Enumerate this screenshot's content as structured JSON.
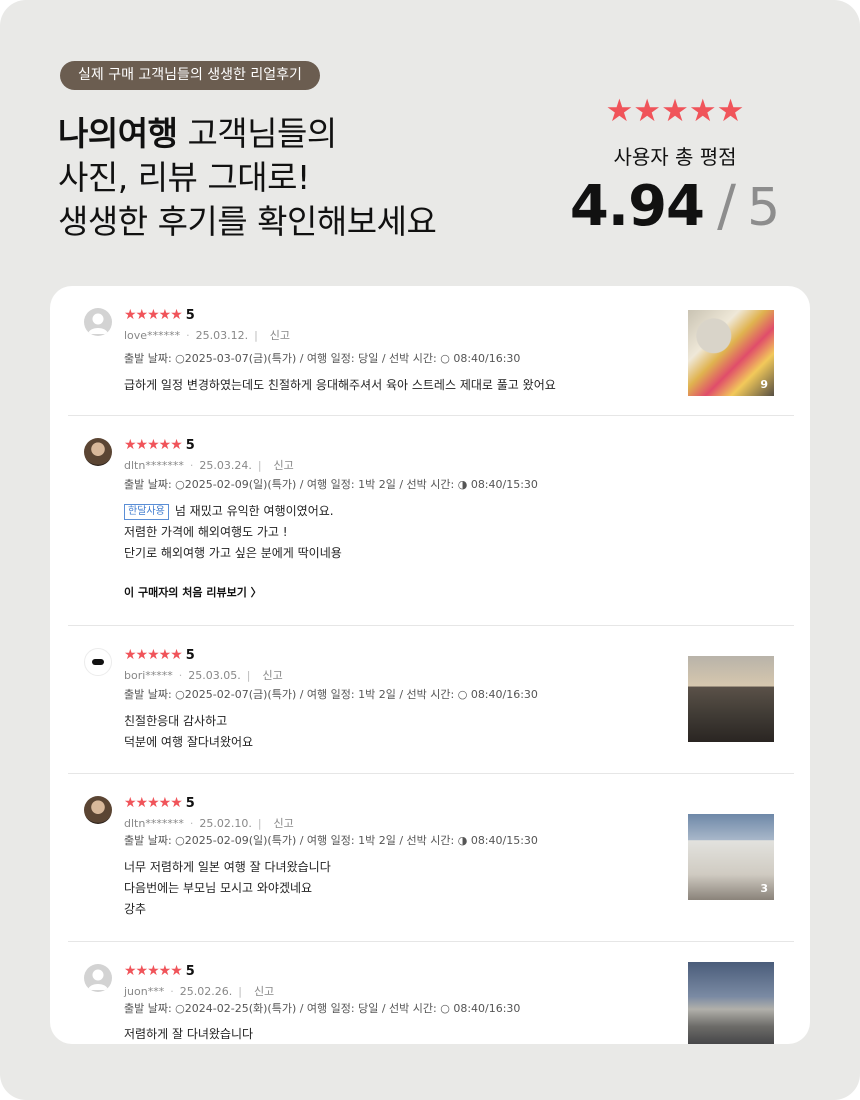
{
  "header": {
    "badge": "실제 구매 고객님들의 생생한 리얼후기",
    "headline_brand": "나의여행",
    "headline_rest": " 고객님들의",
    "headline_line2": "사진, 리뷰 그대로!",
    "headline_line3": "생생한 후기를 확인해보세요"
  },
  "rating": {
    "stars": "★★★★★",
    "label": "사용자 총 평점",
    "score": "4.94",
    "separator": "/",
    "max": "5"
  },
  "reviews": [
    {
      "stars": "★★★★★",
      "score": "5",
      "user": "love******",
      "date": "25.03.12.",
      "report": "신고",
      "option": "출발 날짜: ○2025-03-07(금)(특가) / 여행 일정: 당일 / 선박 시간: ○ 08:40/16:30",
      "lines": [
        "급하게 일정 변경하였는데도 친절하게 응대해주셔서 육아 스트레스 제대로 풀고 왔어요"
      ],
      "photo_count": "9"
    },
    {
      "stars": "★★★★★",
      "score": "5",
      "user": "dltn*******",
      "date": "25.03.24.",
      "report": "신고",
      "option": "출발 날짜: ○2025-02-09(일)(특가) / 여행 일정: 1박 2일 / 선박 시간: ◑ 08:40/15:30",
      "tag": "한달사용",
      "lines": [
        "넘 재밌고 유익한 여행이였어요.",
        "저렴한 가격에 해외여행도 가고 !",
        "단기로 해외여행 가고 싶은 분에게 딱이네용"
      ],
      "more_link": "이 구매자의 처음 리뷰보기 〉"
    },
    {
      "stars": "★★★★★",
      "score": "5",
      "user": "bori*****",
      "date": "25.03.05.",
      "report": "신고",
      "option": "출발 날짜: ○2025-02-07(금)(특가) / 여행 일정: 1박 2일 / 선박 시간: ○ 08:40/16:30",
      "lines": [
        "친절한응대 감사하고",
        "덕분에 여행 잘다녀왔어요"
      ]
    },
    {
      "stars": "★★★★★",
      "score": "5",
      "user": "dltn*******",
      "date": "25.02.10.",
      "report": "신고",
      "option": "출발 날짜: ○2025-02-09(일)(특가) / 여행 일정: 1박 2일 / 선박 시간: ◑ 08:40/15:30",
      "lines": [
        "너무 저렴하게 일본 여행 잘 다녀왔습니다",
        "다음번에는 부모님 모시고 와야겠네요",
        "강추"
      ],
      "photo_count": "3"
    },
    {
      "stars": "★★★★★",
      "score": "5",
      "user": "juon***",
      "date": "25.02.26.",
      "report": "신고",
      "option": "출발 날짜: ○2024-02-25(화)(특가) / 여행 일정: 당일 / 선박 시간: ○ 08:40/16:30",
      "lines": [
        "저렴하게 잘 다녀왔습니다"
      ]
    }
  ]
}
